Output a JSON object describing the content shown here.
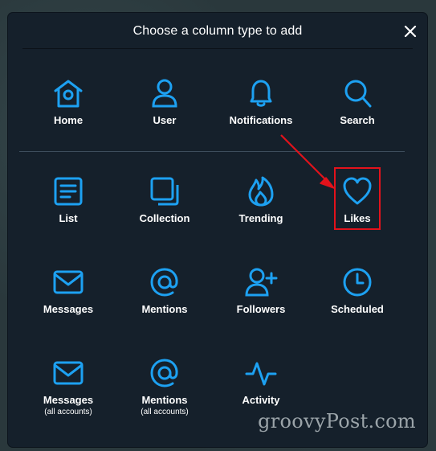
{
  "dialog": {
    "title": "Choose a column type to add",
    "close_icon": "close-icon"
  },
  "columns": [
    {
      "label": "Home",
      "icon": "home-icon"
    },
    {
      "label": "User",
      "icon": "user-icon"
    },
    {
      "label": "Notifications",
      "icon": "bell-icon"
    },
    {
      "label": "Search",
      "icon": "search-icon"
    },
    {
      "label": "List",
      "icon": "list-icon"
    },
    {
      "label": "Collection",
      "icon": "collection-icon"
    },
    {
      "label": "Trending",
      "icon": "flame-icon"
    },
    {
      "label": "Likes",
      "icon": "heart-icon"
    },
    {
      "label": "Messages",
      "icon": "mail-icon"
    },
    {
      "label": "Mentions",
      "icon": "at-icon"
    },
    {
      "label": "Followers",
      "icon": "add-user-icon"
    },
    {
      "label": "Scheduled",
      "icon": "clock-icon"
    },
    {
      "label": "Messages",
      "sublabel": "(all accounts)",
      "icon": "mail-icon"
    },
    {
      "label": "Mentions",
      "sublabel": "(all accounts)",
      "icon": "at-icon"
    },
    {
      "label": "Activity",
      "icon": "activity-icon"
    }
  ],
  "annotation": {
    "highlight_color": "#e3121b",
    "highlighted_item": "Likes"
  },
  "colors": {
    "accent": "#1da1f2",
    "modal_bg": "#15202b",
    "text": "#ffffff"
  },
  "watermark": "groovyPost.com"
}
